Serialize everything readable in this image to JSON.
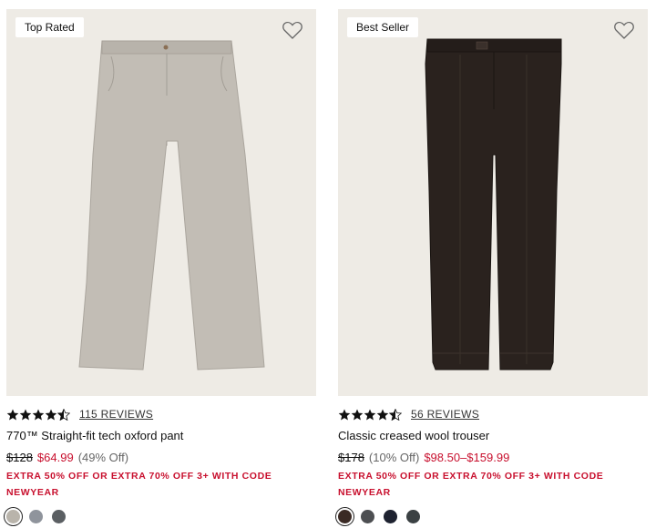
{
  "products": [
    {
      "badge": "Top Rated",
      "rating": 4.5,
      "reviews": "115 REVIEWS",
      "title": "770™ Straight-fit tech oxford pant",
      "price_original": "$128",
      "price_sale": "$64.99",
      "price_off": "(49% Off)",
      "promo": "EXTRA 50% OFF OR EXTRA 70% OFF 3+ WITH CODE",
      "promo_code": "NEWYEAR",
      "pant_color": "#c2bdb5",
      "swatches": [
        {
          "color": "#b9b4ab",
          "selected": true
        },
        {
          "color": "#8f949c",
          "selected": false
        },
        {
          "color": "#5b5f63",
          "selected": false
        }
      ]
    },
    {
      "badge": "Best Seller",
      "rating": 4.5,
      "reviews": "56 REVIEWS",
      "title": "Classic creased wool trouser",
      "price_original": "$178",
      "price_off": "(10% Off)",
      "price_sale": "$98.50–$159.99",
      "promo": "EXTRA 50% OFF OR EXTRA 70% OFF 3+ WITH CODE",
      "promo_code": "NEWYEAR",
      "pant_color": "#2a221e",
      "swatches": [
        {
          "color": "#3a2a24",
          "selected": true
        },
        {
          "color": "#4d4f52",
          "selected": false
        },
        {
          "color": "#1e2230",
          "selected": false
        },
        {
          "color": "#3b4143",
          "selected": false
        }
      ]
    }
  ],
  "colors": {
    "sale": "#c8102e",
    "image_bg": "#eeebe5"
  }
}
